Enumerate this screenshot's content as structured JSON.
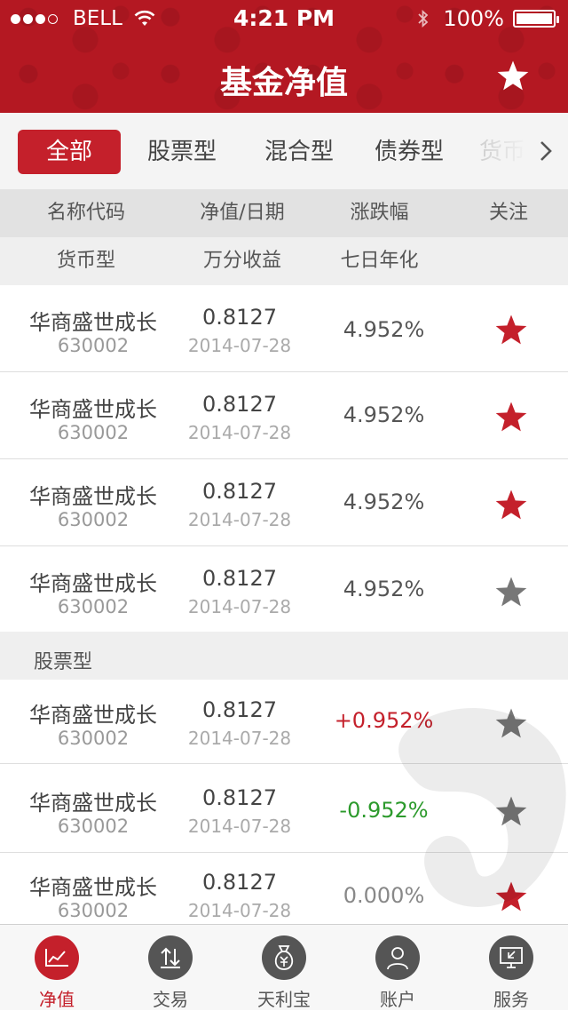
{
  "status_bar": {
    "carrier": "BELL",
    "time": "4:21 PM",
    "battery": "100%"
  },
  "header": {
    "title": "基金净值"
  },
  "tabs": [
    {
      "label": "全部",
      "active": true
    },
    {
      "label": "股票型",
      "active": false
    },
    {
      "label": "混合型",
      "active": false
    },
    {
      "label": "债券型",
      "active": false
    },
    {
      "label": "货币",
      "active": false
    }
  ],
  "columns": {
    "name": "名称代码",
    "nav": "净值/日期",
    "change": "涨跌幅",
    "follow": "关注"
  },
  "money_columns": {
    "type": "货币型",
    "income": "万分收益",
    "annual": "七日年化"
  },
  "money_funds": [
    {
      "name": "华商盛世成长",
      "code": "630002",
      "nav": "0.8127",
      "date": "2014-07-28",
      "rate": "4.952%",
      "trend": "flat",
      "followed": true
    },
    {
      "name": "华商盛世成长",
      "code": "630002",
      "nav": "0.8127",
      "date": "2014-07-28",
      "rate": "4.952%",
      "trend": "flat",
      "followed": true
    },
    {
      "name": "华商盛世成长",
      "code": "630002",
      "nav": "0.8127",
      "date": "2014-07-28",
      "rate": "4.952%",
      "trend": "flat",
      "followed": true
    },
    {
      "name": "华商盛世成长",
      "code": "630002",
      "nav": "0.8127",
      "date": "2014-07-28",
      "rate": "4.952%",
      "trend": "flat",
      "followed": false
    }
  ],
  "stock_section": {
    "title": "股票型"
  },
  "stock_funds": [
    {
      "name": "华商盛世成长",
      "code": "630002",
      "nav": "0.8127",
      "date": "2014-07-28",
      "rate": "+0.952%",
      "trend": "up",
      "followed": false
    },
    {
      "name": "华商盛世成长",
      "code": "630002",
      "nav": "0.8127",
      "date": "2014-07-28",
      "rate": "-0.952%",
      "trend": "down",
      "followed": false
    },
    {
      "name": "华商盛世成长",
      "code": "630002",
      "nav": "0.8127",
      "date": "2014-07-28",
      "rate": "0.000%",
      "trend": "flat",
      "followed": true
    }
  ],
  "tabbar": [
    {
      "label": "净值",
      "icon": "chart-icon",
      "active": true
    },
    {
      "label": "交易",
      "icon": "transfer-icon",
      "active": false
    },
    {
      "label": "天利宝",
      "icon": "money-bag-icon",
      "active": false
    },
    {
      "label": "账户",
      "icon": "user-icon",
      "active": false
    },
    {
      "label": "服务",
      "icon": "service-icon",
      "active": false
    }
  ],
  "colors": {
    "brand_red": "#c4202b",
    "header_red": "#b41822",
    "up": "#c4202b",
    "down": "#2c9a2c",
    "star_off": "#777777"
  }
}
